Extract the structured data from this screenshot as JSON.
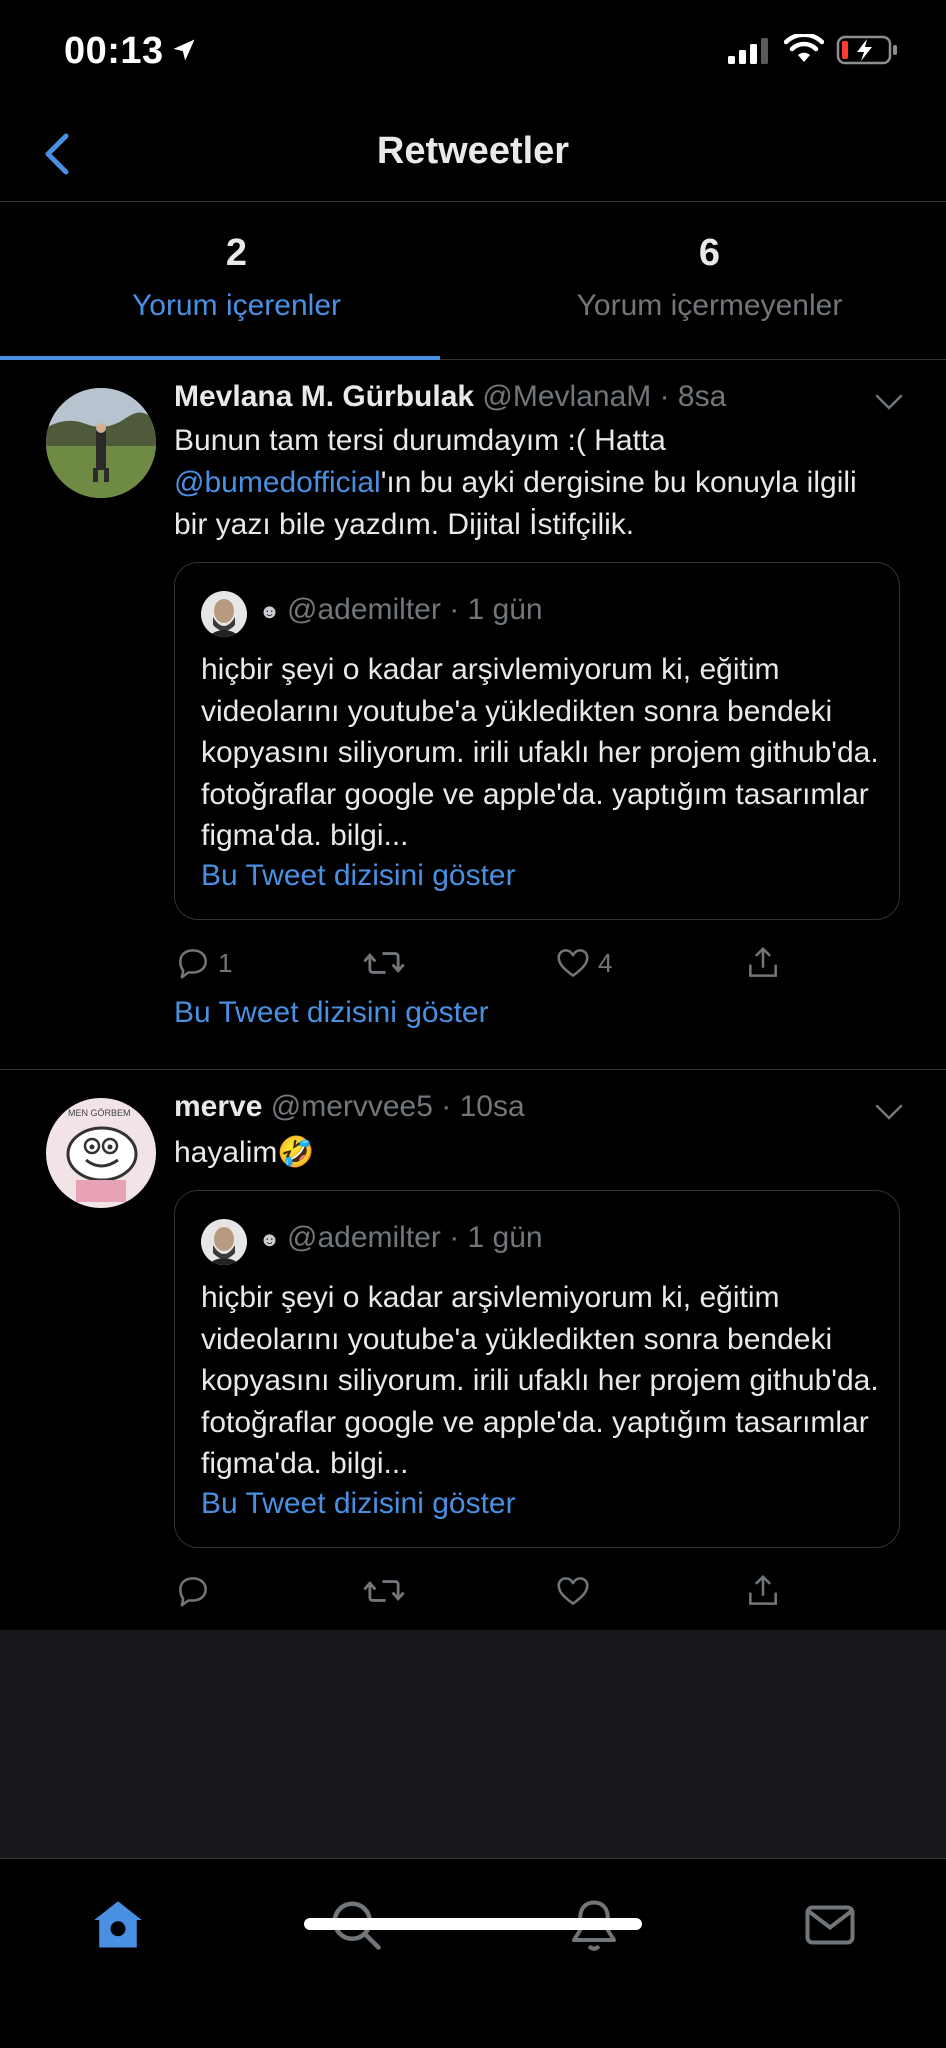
{
  "status": {
    "time": "00:13"
  },
  "nav": {
    "title": "Retweetler"
  },
  "tabs": [
    {
      "count": "2",
      "label": "Yorum içerenler",
      "active": true
    },
    {
      "count": "6",
      "label": "Yorum içermeyenler",
      "active": false
    }
  ],
  "tweets": [
    {
      "name": "Mevlana M. Gürbulak",
      "handle": "@MevlanaM",
      "time": "· 8sa",
      "text_before": "Bunun tam tersi durumdayım :( Hatta ",
      "mention": "@bumedofficial",
      "text_after": "'ın bu ayki dergisine bu konuyla ilgili bir yazı bile yazdım. Dijital İstifçilik.",
      "quote": {
        "smile": "☻",
        "handle": "@ademilter",
        "time": "· 1 gün",
        "text": "hiçbir şeyi o kadar arşivlemiyorum ki, eğitim videolarını youtube'a yükledikten sonra bendeki kopyasını siliyorum. irili ufaklı her projem github'da. fotoğraflar google ve apple'da. yaptığım tasarımlar figma'da. bilgi...",
        "thread_link": "Bu Tweet dizisini göster"
      },
      "replies": "1",
      "retweets": "",
      "likes": "4",
      "thread_link": "Bu Tweet dizisini göster"
    },
    {
      "name": "merve",
      "handle": "@mervvee5",
      "time": "· 10sa",
      "text": "hayalim🤣",
      "quote": {
        "smile": "☻",
        "handle": "@ademilter",
        "time": "· 1 gün",
        "text": "hiçbir şeyi o kadar arşivlemiyorum ki, eğitim videolarını youtube'a yükledikten sonra bendeki kopyasını siliyorum. irili ufaklı her projem github'da. fotoğraflar google ve apple'da. yaptığım tasarımlar figma'da. bilgi...",
        "thread_link": "Bu Tweet dizisini göster"
      },
      "replies": "",
      "retweets": "",
      "likes": ""
    }
  ],
  "colors": {
    "accent": "#4a90e2",
    "muted": "#71767b",
    "border": "#2f3336",
    "background": "#000000"
  },
  "tabbar": [
    "home-icon",
    "search-icon",
    "bell-icon",
    "mail-icon"
  ]
}
